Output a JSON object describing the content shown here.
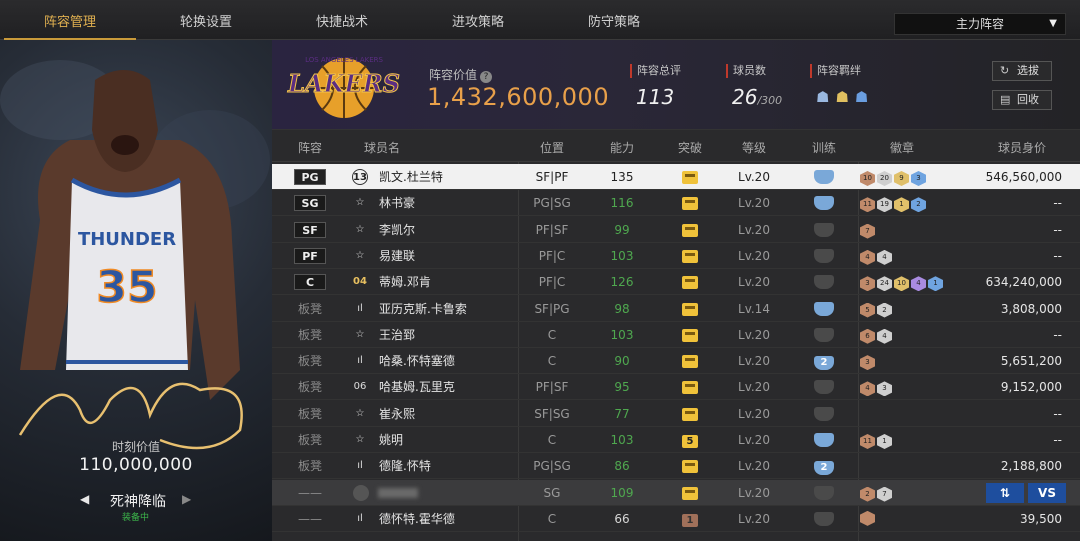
{
  "nav": {
    "tabs": [
      "阵容管理",
      "轮换设置",
      "快捷战术",
      "进攻策略",
      "防守策略"
    ],
    "lineup_select": "主力阵容"
  },
  "player_card": {
    "moment_label": "时刻价值",
    "moment_value": "110,000,000",
    "skill_name": "死神降临",
    "skill_status": "装备中"
  },
  "team": {
    "value_label": "阵容价值",
    "value": "1,432,600,000",
    "rating_label": "阵容总评",
    "rating": "113",
    "players_label": "球员数",
    "players": "26",
    "players_max": "/300",
    "bond_label": "阵容羁绊",
    "swap_button": "选拔",
    "recycle_button": "回收"
  },
  "table": {
    "headers": [
      "阵容",
      "球员名",
      "位置",
      "能力",
      "突破",
      "等级",
      "训练",
      "徽章",
      "球员身价"
    ],
    "rows": [
      {
        "slot": "PG",
        "bench": false,
        "num": "13",
        "name": "凯文.杜兰特",
        "position": "SF|PF",
        "ability": "135",
        "green": false,
        "breakthrough": "",
        "level": "Lv.20",
        "train": "blue",
        "train_text": "",
        "badges": [
          [
            "b",
            "10"
          ],
          [
            "s",
            "20"
          ],
          [
            "g",
            "9"
          ],
          [
            "u",
            "3"
          ]
        ],
        "price": "546,560,000",
        "selected": true
      },
      {
        "slot": "SG",
        "bench": false,
        "num": "☆",
        "name": "林书豪",
        "position": "PG|SG",
        "ability": "116",
        "green": true,
        "breakthrough": "",
        "level": "Lv.20",
        "train": "blue",
        "train_text": "",
        "badges": [
          [
            "b",
            "11"
          ],
          [
            "s",
            "19"
          ],
          [
            "g",
            "1"
          ],
          [
            "u",
            "2"
          ]
        ],
        "price": "--"
      },
      {
        "slot": "SF",
        "bench": false,
        "num": "☆",
        "name": "李凯尔",
        "position": "PF|SF",
        "ability": "99",
        "green": true,
        "breakthrough": "",
        "level": "Lv.20",
        "train": "dim",
        "train_text": "",
        "badges": [
          [
            "b",
            "7"
          ]
        ],
        "price": "--"
      },
      {
        "slot": "PF",
        "bench": false,
        "num": "☆",
        "name": "易建联",
        "position": "PF|C",
        "ability": "103",
        "green": true,
        "breakthrough": "",
        "level": "Lv.20",
        "train": "dim",
        "train_text": "",
        "badges": [
          [
            "b",
            "4"
          ],
          [
            "s",
            "4"
          ]
        ],
        "price": "--"
      },
      {
        "slot": "C",
        "bench": false,
        "num": "04",
        "name": "蒂姆.邓肯",
        "position": "PF|C",
        "ability": "126",
        "green": true,
        "breakthrough": "",
        "level": "Lv.20",
        "train": "dim",
        "train_text": "",
        "badges": [
          [
            "b",
            "3"
          ],
          [
            "s",
            "24"
          ],
          [
            "g",
            "10"
          ],
          [
            "p",
            "4"
          ],
          [
            "u",
            "1"
          ]
        ],
        "price": "634,240,000"
      },
      {
        "slot": "板凳",
        "bench": true,
        "num": "ıl",
        "name": "亚历克斯.卡鲁索",
        "position": "SF|PG",
        "ability": "98",
        "green": true,
        "breakthrough": "",
        "level": "Lv.14",
        "train": "blue",
        "train_text": "",
        "badges": [
          [
            "b",
            "5"
          ],
          [
            "s",
            "2"
          ]
        ],
        "price": "3,808,000"
      },
      {
        "slot": "板凳",
        "bench": true,
        "num": "☆",
        "name": "王治郅",
        "position": "C",
        "ability": "103",
        "green": true,
        "breakthrough": "",
        "level": "Lv.20",
        "train": "dim",
        "train_text": "",
        "badges": [
          [
            "b",
            "6"
          ],
          [
            "s",
            "4"
          ]
        ],
        "price": "--"
      },
      {
        "slot": "板凳",
        "bench": true,
        "num": "ıl",
        "name": "哈桑.怀特塞德",
        "position": "C",
        "ability": "90",
        "green": true,
        "breakthrough": "",
        "level": "Lv.20",
        "train": "blue",
        "train_text": "2",
        "badges": [
          [
            "b",
            "3"
          ]
        ],
        "price": "5,651,200"
      },
      {
        "slot": "板凳",
        "bench": true,
        "num": "06",
        "name": "哈基姆.瓦里克",
        "position": "PF|SF",
        "ability": "95",
        "green": true,
        "breakthrough": "",
        "level": "Lv.20",
        "train": "dim",
        "train_text": "",
        "badges": [
          [
            "b",
            "4"
          ],
          [
            "s",
            "3"
          ]
        ],
        "price": "9,152,000"
      },
      {
        "slot": "板凳",
        "bench": true,
        "num": "☆",
        "name": "崔永熙",
        "position": "SF|SG",
        "ability": "77",
        "green": true,
        "breakthrough": "",
        "level": "Lv.20",
        "train": "dim",
        "train_text": "",
        "badges": [],
        "price": "--"
      },
      {
        "slot": "板凳",
        "bench": true,
        "num": "☆",
        "name": "姚明",
        "position": "C",
        "ability": "103",
        "green": true,
        "breakthrough": "5",
        "level": "Lv.20",
        "train": "blue",
        "train_text": "",
        "badges": [
          [
            "b",
            "11"
          ],
          [
            "s",
            "1"
          ]
        ],
        "price": "--"
      },
      {
        "slot": "板凳",
        "bench": true,
        "num": "ıl",
        "name": "德隆.怀特",
        "position": "PG|SG",
        "ability": "86",
        "green": true,
        "breakthrough": "",
        "level": "Lv.20",
        "train": "blue",
        "train_text": "2",
        "badges": [],
        "price": "2,188,800"
      },
      {
        "slot": "——",
        "bench": true,
        "num": "avatar",
        "name": "",
        "position": "SG",
        "ability": "109",
        "green": true,
        "breakthrough": "",
        "level": "Lv.20",
        "train": "dim",
        "train_text": "",
        "badges": [
          [
            "b",
            "2"
          ],
          [
            "s",
            "7"
          ]
        ],
        "price": "",
        "me": true,
        "vs_label": "VS"
      },
      {
        "slot": "——",
        "bench": true,
        "num": "ıl",
        "name": "德怀特.霍华德",
        "position": "C",
        "ability": "66",
        "green": false,
        "breakthrough": "1",
        "level": "Lv.20",
        "train": "dim",
        "train_text": "",
        "badges": [
          [
            "b",
            ""
          ]
        ],
        "price": "39,500"
      }
    ]
  },
  "card_text": {
    "jersey_team": "THUNDER",
    "jersey_number": "35"
  },
  "logo_text": "LOS ANGELES LAKERS"
}
